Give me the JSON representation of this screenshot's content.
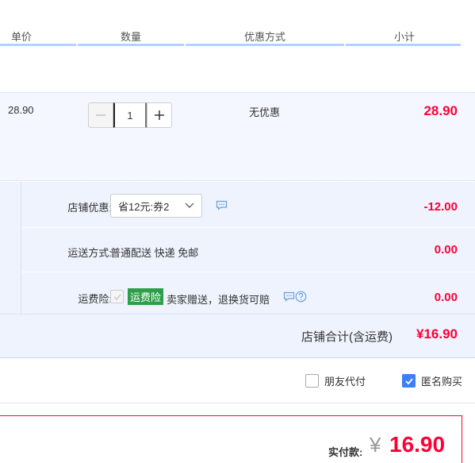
{
  "header": {
    "col_price": "单价",
    "col_qty": "数量",
    "col_promo": "优惠方式",
    "col_subtotal": "小计"
  },
  "item": {
    "price": "28.90",
    "quantity": "1",
    "promo": "无优惠",
    "subtotal": "28.90"
  },
  "store": {
    "coupon_label": "店铺优惠:",
    "coupon_selected": "省12元:券2",
    "coupon_amount": "-12.00",
    "shipping_label": "运送方式:",
    "shipping_value": "普通配送 快递 免邮",
    "shipping_amount": "0.00",
    "insurance_label": "运费险:",
    "insurance_badge": "运费险",
    "insurance_text": "卖家赠送，退换货可赔",
    "insurance_amount": "0.00",
    "total_label": "店铺合计(含运费)",
    "total_amount": "¥16.90"
  },
  "options": {
    "friend_pay": "朋友代付",
    "friend_pay_checked": false,
    "anonymous": "匿名购买",
    "anonymous_checked": true
  },
  "payment": {
    "label": "实付款:",
    "currency": "¥",
    "amount": "16.90"
  },
  "colors": {
    "accent_red": "#ff0036",
    "header_line": "#b2d1ff",
    "item_bg": "#f4f7ff",
    "store_bg": "#eef3fd",
    "checkbox_blue": "#3d7ff5",
    "insurance_green": "#2f9e4a"
  },
  "icons": [
    "minus-icon",
    "plus-icon",
    "chevron-down-icon",
    "chat-bubble-icon",
    "help-circle-icon",
    "checkmark-icon"
  ]
}
